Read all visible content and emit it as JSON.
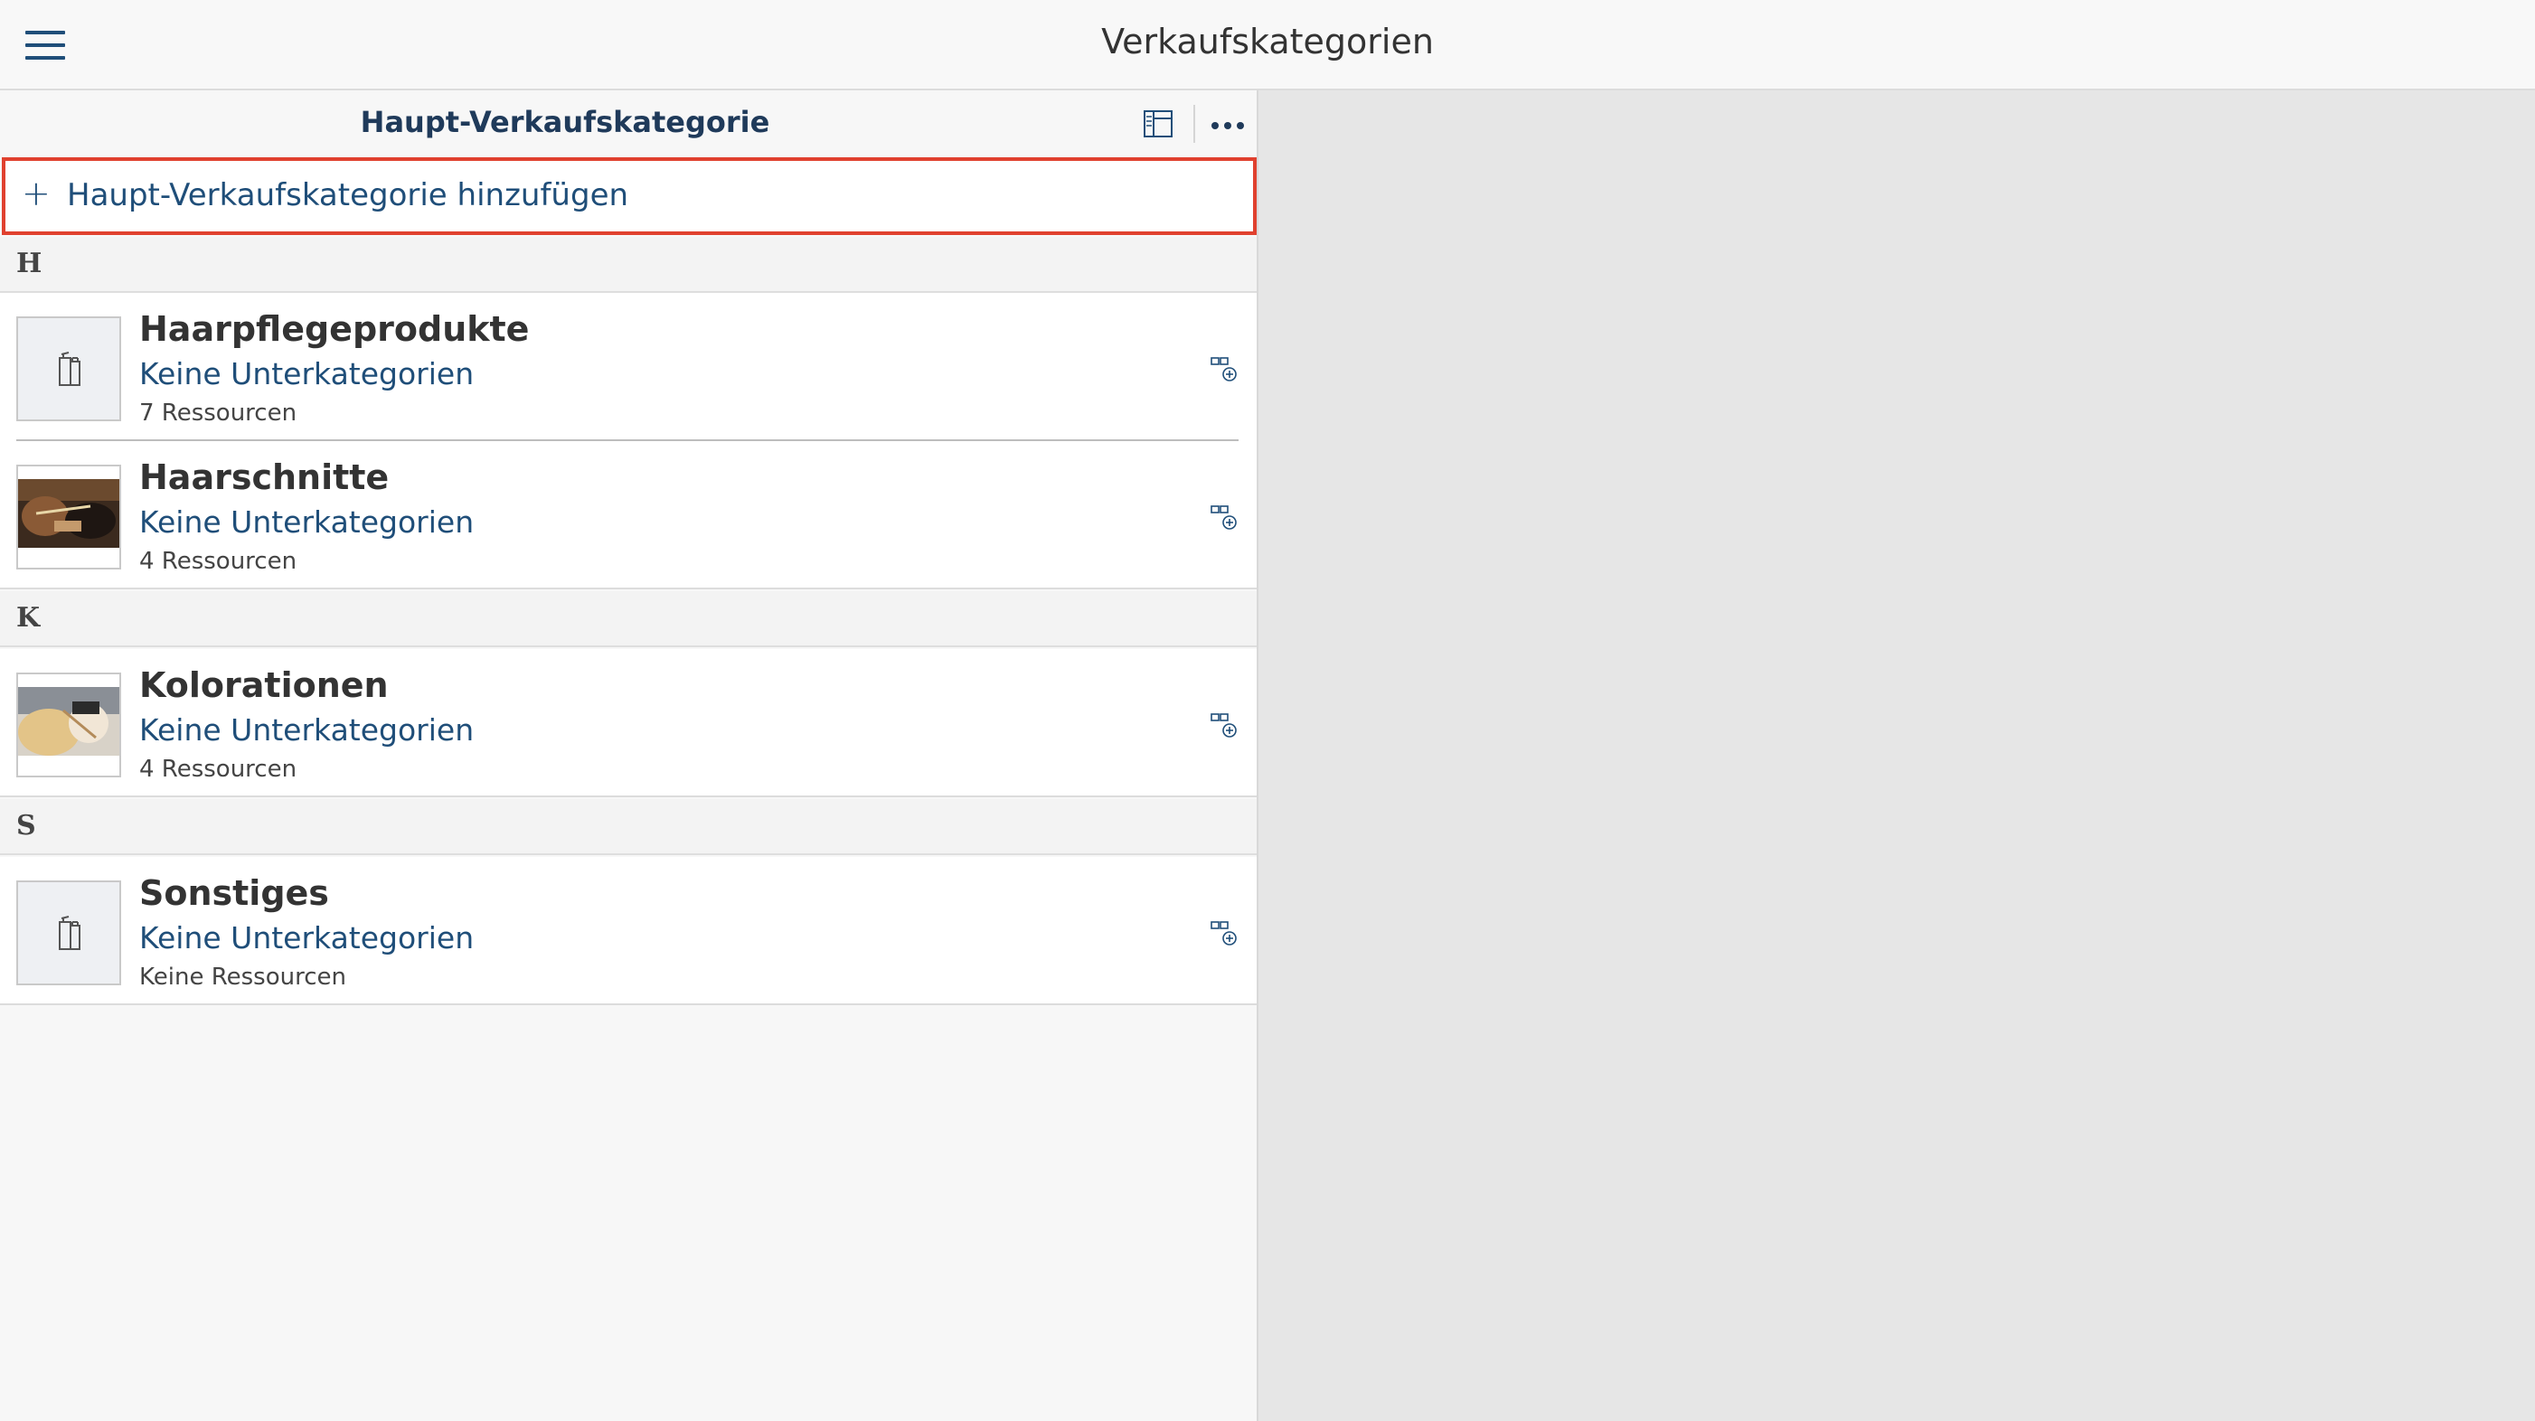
{
  "app": {
    "title": "Verkaufskategorien"
  },
  "panel": {
    "title": "Haupt-Verkaufskategorie",
    "add_label": "Haupt-Verkaufskategorie hinzufügen"
  },
  "sections": [
    {
      "letter": "H",
      "items": [
        {
          "title": "Haarpflegeprodukte",
          "subtitle": "Keine Unterkategorien",
          "meta": "7 Ressourcen",
          "thumb": "product-icon"
        },
        {
          "title": "Haarschnitte",
          "subtitle": "Keine Unterkategorien",
          "meta": "4 Ressourcen",
          "thumb": "photo-haircut"
        }
      ]
    },
    {
      "letter": "K",
      "items": [
        {
          "title": "Kolorationen",
          "subtitle": "Keine Unterkategorien",
          "meta": "4 Ressourcen",
          "thumb": "photo-coloring"
        }
      ]
    },
    {
      "letter": "S",
      "items": [
        {
          "title": "Sonstiges",
          "subtitle": "Keine Unterkategorien",
          "meta": "Keine Ressourcen",
          "thumb": "product-icon"
        }
      ]
    }
  ],
  "colors": {
    "accent": "#1f4e79",
    "highlight_border": "#e0412f",
    "detail_bg": "#e6e6e6"
  }
}
